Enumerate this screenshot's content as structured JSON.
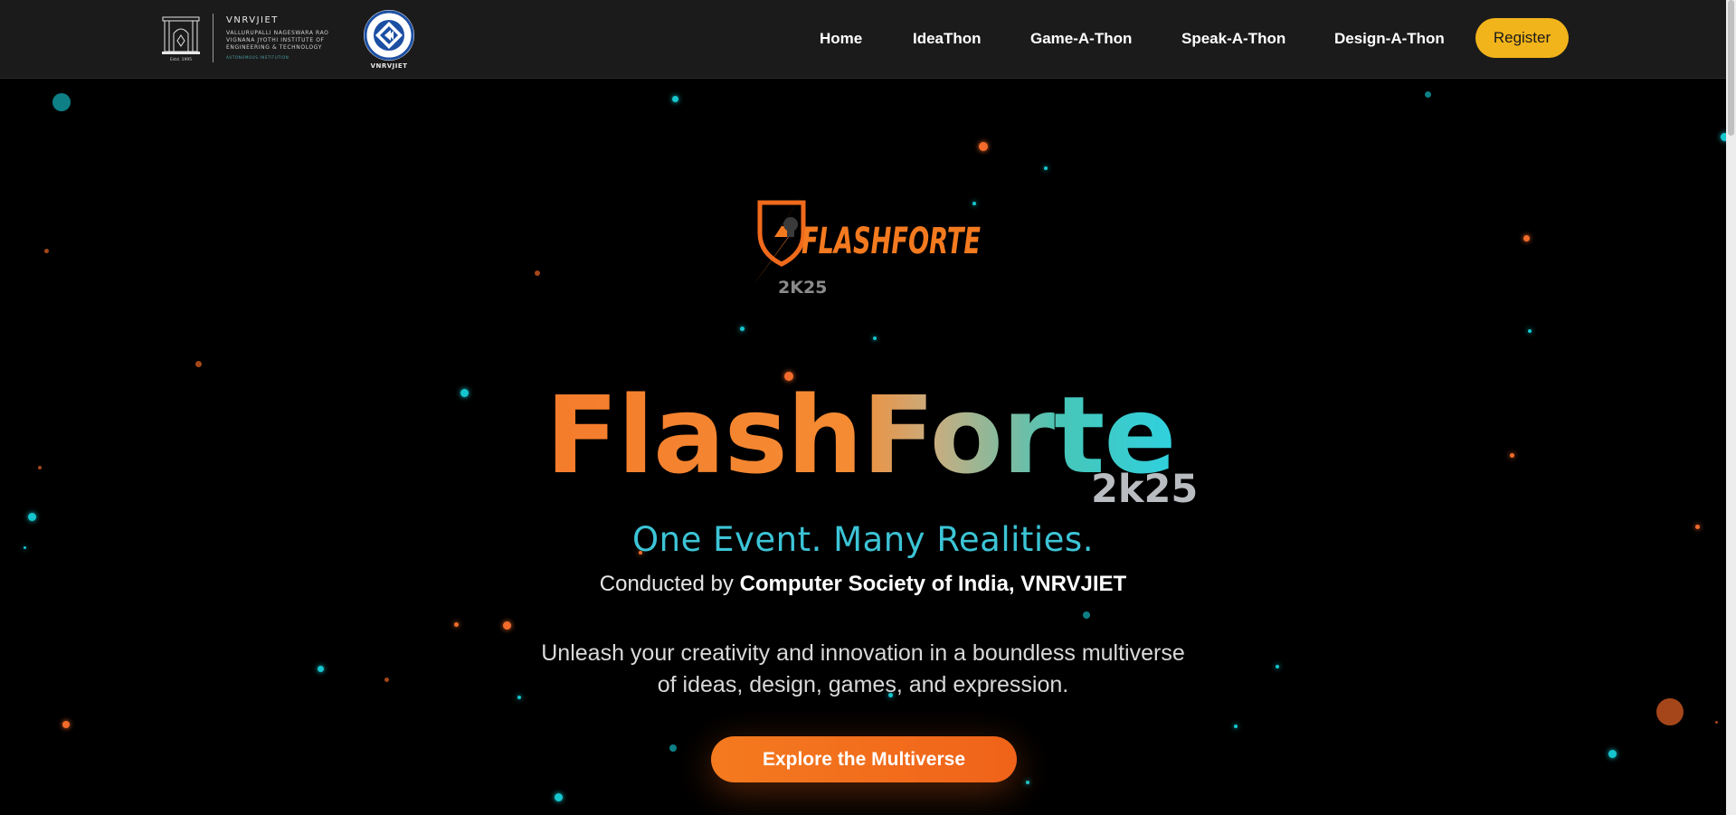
{
  "header": {
    "college": {
      "short_name": "VNRVJIET",
      "line1": "VALLURUPALLI NAGESWARA RAO",
      "line2": "VIGNANA JYOTHI INSTITUTE OF",
      "line3": "ENGINEERING & TECHNOLOGY",
      "line4": "AUTONOMOUS INSTITUTION",
      "emblem_text": "Estd. 1995"
    },
    "csi": {
      "caption": "VNRVJIET"
    },
    "nav": [
      {
        "label": "Home"
      },
      {
        "label": "IdeaThon"
      },
      {
        "label": "Game-A-Thon"
      },
      {
        "label": "Speak-A-Thon"
      },
      {
        "label": "Design-A-Thon"
      }
    ],
    "register_label": "Register",
    "colors": {
      "register_bg": "#f2b41b",
      "nav_bg": "#1b1b1b"
    }
  },
  "hero": {
    "logo": {
      "wordmark": "FLASHFORTE",
      "year": "2K25",
      "icon": "lightning-shield-icon"
    },
    "title": "FlashForte",
    "year": "2k25",
    "tagline": "One Event. Many Realities.",
    "conducted_prefix": "Conducted by",
    "conducted_org": "Computer Society of India, VNRVJIET",
    "description_line1": "Unleash your creativity and innovation in a boundless multiverse",
    "description_line2": "of ideas, design, games, and expression.",
    "cta_label": "Explore the Multiverse",
    "colors": {
      "accent_orange": "#f47a1f",
      "accent_cyan": "#2fd1df"
    }
  }
}
